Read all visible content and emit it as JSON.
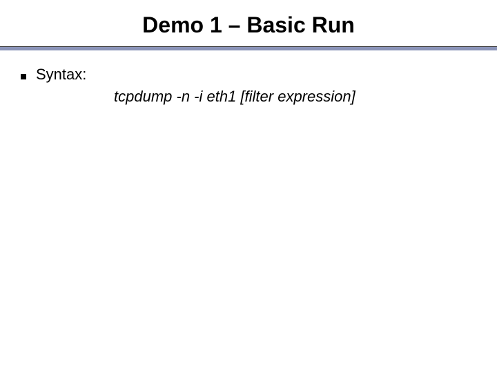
{
  "title": "Demo 1 – Basic Run",
  "content": {
    "bullet_label": "Syntax:",
    "command": "tcpdump -n -i eth1 [filter expression]"
  }
}
